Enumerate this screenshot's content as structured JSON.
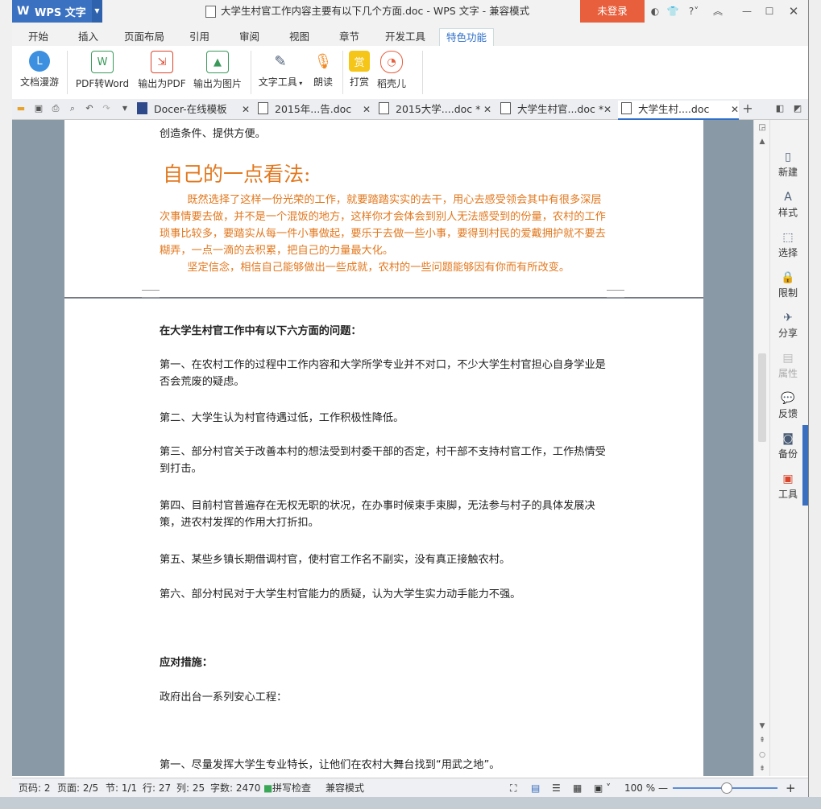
{
  "titlebar": {
    "app_name": "WPS 文字",
    "doc_title": "大学生村官工作内容主要有以下几个方面.doc - WPS 文字 - 兼容模式",
    "login": "未登录",
    "help": "?"
  },
  "menu": {
    "tabs": [
      "开始",
      "插入",
      "页面布局",
      "引用",
      "审阅",
      "视图",
      "章节",
      "开发工具",
      "特色功能"
    ],
    "active": "特色功能"
  },
  "ribbon": {
    "buttons": [
      {
        "label": "文档漫游",
        "icon": "cloud-icon",
        "color": "#3d8fe0"
      },
      {
        "label": "PDF转Word",
        "icon": "pdf-to-word-icon",
        "color": "#3a9a5a"
      },
      {
        "label": "输出为PDF",
        "icon": "export-pdf-icon",
        "color": "#d9452b"
      },
      {
        "label": "输出为图片",
        "icon": "export-image-icon",
        "color": "#3a9a5a"
      },
      {
        "label": "文字工具",
        "icon": "text-tools-icon",
        "color": "#4a5c75"
      },
      {
        "label": "朗读",
        "icon": "microphone-icon",
        "color": "#f08a24"
      },
      {
        "label": "打赏",
        "icon": "reward-icon",
        "color": "#f5c518"
      },
      {
        "label": "稻壳儿",
        "icon": "docer-icon",
        "color": "#e85f3d"
      }
    ],
    "reward_glyph": "赏"
  },
  "doc_tabs": [
    {
      "label": "Docer-在线模板",
      "active": false
    },
    {
      "label": "2015年...告.doc",
      "active": false
    },
    {
      "label": "2015大学....doc *",
      "active": false
    },
    {
      "label": "大学生村官...doc *",
      "active": false
    },
    {
      "label": "大学生村....doc",
      "active": true
    }
  ],
  "page1": {
    "line_top": "创造条件、提供方便。",
    "heading": "自己的一点看法:",
    "para1": "既然选择了这样一份光荣的工作，就要踏踏实实的去干，用心去感受领会其中有很多深层次事情要去做，并不是一个混饭的地方，这样你才会体会到别人无法感受到的份量，农村的工作琐事比较多，要踏实从每一件小事做起，要乐于去做一些小事，要得到村民的爱戴拥护就不要去糊弄，一点一滴的去积累，把自己的力量最大化。",
    "para2": "坚定信念，相信自己能够做出一些成就，农村的一些问题能够因有你而有所改变。"
  },
  "page2": {
    "heading": "在大学生村官工作中有以下六方面的问题：",
    "items": [
      "第一、在农村工作的过程中工作内容和大学所学专业并不对口，不少大学生村官担心自身学业是否会荒废的疑虑。",
      "第二、大学生认为村官待遇过低，工作积极性降低。",
      "第三、部分村官关于改善本村的想法受到村委干部的否定，村干部不支持村官工作，工作热情受到打击。",
      "第四、目前村官普遍存在无权无职的状况，在办事时候束手束脚，无法参与村子的具体发展决策，进农村发挥的作用大打折扣。",
      "第五、某些乡镇长期借调村官，使村官工作名不副实，没有真正接触农村。",
      "第六、部分村民对于大学生村官能力的质疑，认为大学生实力动手能力不强。"
    ],
    "measures_heading": "应对措施：",
    "measures_intro": "政府出台一系列安心工程：",
    "measure1": "第一、尽量发挥大学生专业特长，让他们在农村大舞台找到“用武之地”。"
  },
  "side_panel": [
    "新建",
    "样式",
    "选择",
    "限制",
    "分享",
    "属性",
    "反馈",
    "备份",
    "工具"
  ],
  "statusbar": {
    "page_no": "页码: 2",
    "pages": "页面: 2/5",
    "section": "节: 1/1",
    "row": "行: 27",
    "col": "列: 25",
    "words": "字数: 2470",
    "spell": "拼写检查",
    "compat": "兼容模式",
    "zoom": "100 %"
  }
}
